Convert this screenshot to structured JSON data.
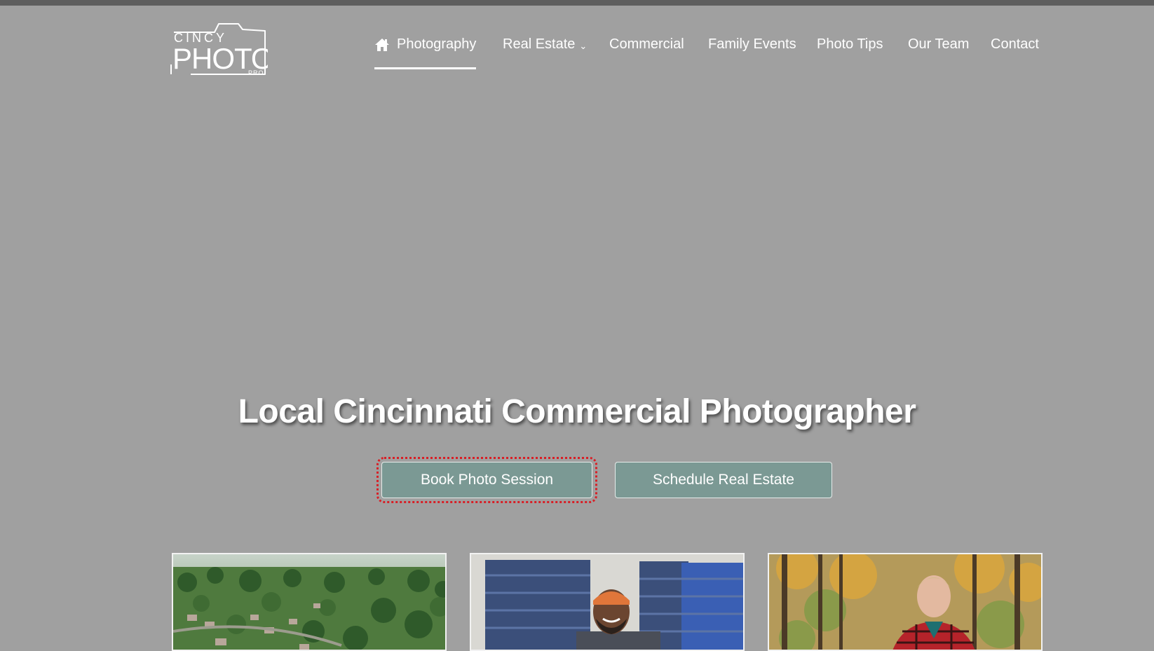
{
  "logo": {
    "line1": "CINCY",
    "line2": "PHOTO",
    "line3": "PRO"
  },
  "nav": {
    "items": [
      {
        "label": "Photography",
        "icon": "home-icon",
        "active": true
      },
      {
        "label": "Real Estate",
        "icon": "chevron-down-icon"
      },
      {
        "label": "Commercial"
      },
      {
        "label": "Family Events"
      },
      {
        "label": "Photo Tips"
      },
      {
        "label": "Our Team"
      },
      {
        "label": "Contact"
      }
    ]
  },
  "hero": {
    "title": "Local Cincinnati Commercial Photographer",
    "buttons": {
      "book": "Book Photo Session",
      "schedule": "Schedule Real Estate"
    }
  },
  "cards": [
    {
      "subject": "aerial neighborhood photo"
    },
    {
      "subject": "smiling man among blue crates"
    },
    {
      "subject": "young man in autumn woods"
    }
  ],
  "colors": {
    "background": "#a0a0a0",
    "button": "#7b9994",
    "focus_outline": "#d81f26",
    "text": "#ffffff"
  }
}
